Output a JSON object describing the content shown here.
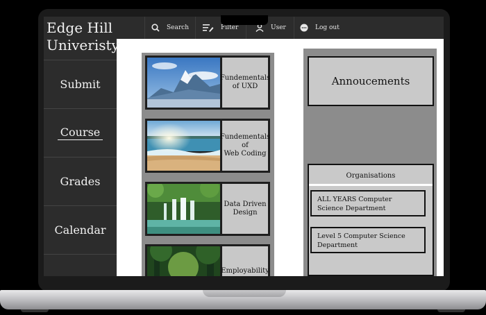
{
  "sidebar": {
    "brand": "Edge Hill\nUniveristy",
    "items": [
      {
        "label": "Submit"
      },
      {
        "label": "Course"
      },
      {
        "label": "Grades"
      },
      {
        "label": "Calendar"
      }
    ]
  },
  "topbar": {
    "search": "Search",
    "filter": "Filter",
    "user": "User",
    "logout": "Log out"
  },
  "courses": [
    {
      "title": "Fundementals\nof UXD"
    },
    {
      "title": "Fundementals\nof\nWeb Coding"
    },
    {
      "title": "Data Driven\nDesign"
    },
    {
      "title": "Employability"
    }
  ],
  "announcements": {
    "title": "Annoucements"
  },
  "organisations": {
    "title": "Organisations",
    "items": [
      {
        "label": "ALL YEARS Computer\nScience Department"
      },
      {
        "label": "Level 5 Computer Science\nDepartment"
      }
    ]
  },
  "icons": {
    "search": "search-icon",
    "filter": "filter-edit-icon",
    "user": "user-icon",
    "logout": "logout-icon"
  }
}
